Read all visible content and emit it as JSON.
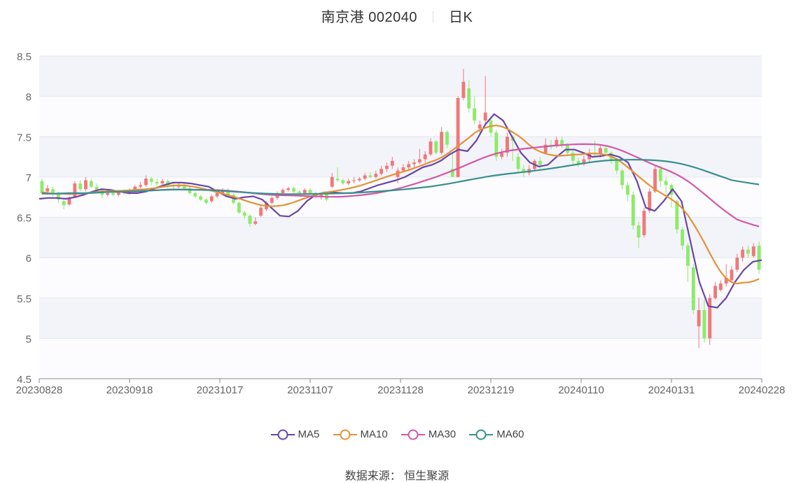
{
  "header": {
    "title": "南京港 002040",
    "period": "日K"
  },
  "source": {
    "label": "数据来源：",
    "value": "恒生聚源"
  },
  "colors": {
    "up": "#f07878",
    "down": "#8deb6a",
    "grid_band": "#f3f4fa",
    "MA5": "#6a45a8",
    "MA10": "#e39236",
    "MA30": "#d457a6",
    "MA60": "#37908f"
  },
  "chart_data": {
    "type": "candlestick",
    "title": "南京港 002040 日K",
    "ylim": [
      4.5,
      8.5
    ],
    "yticks": [
      "4.5",
      "5",
      "5.5",
      "6",
      "6.5",
      "7",
      "7.5",
      "8",
      "8.5"
    ],
    "xticks": [
      "20230828",
      "20230918",
      "20231017",
      "20231107",
      "20231128",
      "20231219",
      "20240110",
      "20240131",
      "20240228"
    ],
    "ohlc": [
      [
        6.95,
        6.8,
        6.98,
        6.78
      ],
      [
        6.82,
        6.86,
        6.9,
        6.78
      ],
      [
        6.85,
        6.8,
        6.88,
        6.76
      ],
      [
        6.8,
        6.72,
        6.82,
        6.68
      ],
      [
        6.7,
        6.65,
        6.72,
        6.6
      ],
      [
        6.66,
        6.74,
        6.76,
        6.64
      ],
      [
        6.75,
        6.92,
        6.95,
        6.74
      ],
      [
        6.92,
        6.85,
        6.96,
        6.82
      ],
      [
        6.85,
        6.96,
        7.0,
        6.82
      ],
      [
        6.95,
        6.88,
        6.98,
        6.86
      ],
      [
        6.88,
        6.84,
        6.92,
        6.8
      ],
      [
        6.84,
        6.78,
        6.86,
        6.74
      ],
      [
        6.78,
        6.8,
        6.82,
        6.76
      ],
      [
        6.8,
        6.78,
        6.84,
        6.76
      ],
      [
        6.78,
        6.82,
        6.84,
        6.76
      ],
      [
        6.82,
        6.8,
        6.85,
        6.78
      ],
      [
        6.8,
        6.84,
        6.86,
        6.78
      ],
      [
        6.84,
        6.88,
        6.9,
        6.82
      ],
      [
        6.88,
        6.9,
        6.94,
        6.86
      ],
      [
        6.9,
        6.98,
        7.02,
        6.88
      ],
      [
        6.98,
        6.94,
        7.0,
        6.9
      ],
      [
        6.94,
        6.92,
        6.98,
        6.88
      ],
      [
        6.92,
        6.95,
        6.98,
        6.9
      ],
      [
        6.95,
        6.9,
        6.97,
        6.86
      ],
      [
        6.9,
        6.88,
        6.92,
        6.85
      ],
      [
        6.88,
        6.9,
        6.93,
        6.86
      ],
      [
        6.9,
        6.86,
        6.92,
        6.84
      ],
      [
        6.86,
        6.8,
        6.88,
        6.78
      ],
      [
        6.8,
        6.76,
        6.82,
        6.74
      ],
      [
        6.76,
        6.72,
        6.78,
        6.7
      ],
      [
        6.72,
        6.68,
        6.74,
        6.66
      ],
      [
        6.7,
        6.76,
        6.78,
        6.68
      ],
      [
        6.76,
        6.8,
        6.82,
        6.74
      ],
      [
        6.8,
        6.84,
        6.86,
        6.78
      ],
      [
        6.84,
        6.78,
        6.86,
        6.76
      ],
      [
        6.78,
        6.68,
        6.8,
        6.66
      ],
      [
        6.68,
        6.56,
        6.7,
        6.54
      ],
      [
        6.56,
        6.52,
        6.58,
        6.48
      ],
      [
        6.52,
        6.42,
        6.54,
        6.38
      ],
      [
        6.42,
        6.45,
        6.5,
        6.4
      ],
      [
        6.52,
        6.62,
        6.65,
        6.5
      ],
      [
        6.6,
        6.68,
        6.7,
        6.58
      ],
      [
        6.68,
        6.74,
        6.76,
        6.66
      ],
      [
        6.74,
        6.8,
        6.82,
        6.72
      ],
      [
        6.8,
        6.84,
        6.86,
        6.78
      ],
      [
        6.84,
        6.86,
        6.88,
        6.82
      ],
      [
        6.86,
        6.82,
        6.88,
        6.8
      ],
      [
        6.82,
        6.8,
        6.84,
        6.78
      ],
      [
        6.8,
        6.84,
        6.86,
        6.78
      ],
      [
        6.84,
        6.8,
        6.86,
        6.78
      ],
      [
        6.8,
        6.76,
        6.82,
        6.74
      ],
      [
        6.76,
        6.78,
        6.8,
        6.72
      ],
      [
        6.8,
        6.72,
        6.82,
        6.7
      ],
      [
        6.88,
        7.0,
        7.05,
        6.86
      ],
      [
        6.98,
        6.96,
        7.12,
        6.94
      ],
      [
        6.96,
        6.92,
        6.98,
        6.9
      ],
      [
        6.92,
        6.95,
        6.98,
        6.9
      ],
      [
        6.95,
        6.96,
        7.0,
        6.92
      ],
      [
        6.96,
        6.98,
        7.0,
        6.94
      ],
      [
        6.98,
        7.02,
        7.05,
        6.96
      ],
      [
        7.02,
        7.0,
        7.06,
        6.98
      ],
      [
        7.0,
        7.04,
        7.08,
        6.98
      ],
      [
        7.04,
        7.1,
        7.14,
        7.02
      ],
      [
        7.1,
        7.14,
        7.18,
        7.06
      ],
      [
        7.14,
        7.2,
        7.25,
        7.1
      ],
      [
        7.0,
        7.08,
        7.12,
        6.92
      ],
      [
        7.08,
        7.12,
        7.16,
        7.06
      ],
      [
        7.12,
        7.16,
        7.2,
        7.08
      ],
      [
        7.16,
        7.18,
        7.22,
        7.12
      ],
      [
        7.18,
        7.22,
        7.35,
        7.16
      ],
      [
        7.22,
        7.28,
        7.32,
        7.18
      ],
      [
        7.28,
        7.44,
        7.48,
        7.26
      ],
      [
        7.44,
        7.3,
        7.46,
        7.28
      ],
      [
        7.3,
        7.56,
        7.62,
        7.28
      ],
      [
        7.56,
        7.4,
        7.58,
        7.36
      ],
      [
        7.1,
        7.0,
        7.3,
        7.0
      ],
      [
        7.0,
        7.98,
        8.0,
        7.02
      ],
      [
        7.98,
        8.18,
        8.34,
        7.95
      ],
      [
        8.1,
        7.85,
        8.2,
        7.8
      ],
      [
        7.85,
        7.7,
        8.0,
        7.65
      ],
      [
        7.6,
        7.65,
        7.7,
        7.55
      ],
      [
        7.7,
        7.8,
        8.25,
        7.66
      ],
      [
        7.7,
        7.55,
        7.75,
        7.5
      ],
      [
        7.55,
        7.25,
        7.58,
        7.2
      ],
      [
        7.25,
        7.3,
        7.35,
        7.22
      ],
      [
        7.3,
        7.5,
        7.55,
        7.25
      ],
      [
        7.5,
        7.45,
        7.52,
        7.2
      ],
      [
        7.25,
        7.1,
        7.3,
        7.05
      ],
      [
        7.1,
        7.05,
        7.15,
        7.0
      ],
      [
        7.05,
        7.1,
        7.15,
        7.02
      ],
      [
        7.1,
        7.2,
        7.22,
        7.08
      ],
      [
        7.2,
        7.15,
        7.25,
        7.1
      ],
      [
        7.3,
        7.4,
        7.48,
        7.28
      ],
      [
        7.4,
        7.38,
        7.46,
        7.34
      ],
      [
        7.38,
        7.46,
        7.5,
        7.36
      ],
      [
        7.46,
        7.4,
        7.5,
        7.36
      ],
      [
        7.4,
        7.3,
        7.42,
        7.26
      ],
      [
        7.3,
        7.2,
        7.34,
        7.16
      ],
      [
        7.2,
        7.16,
        7.24,
        7.12
      ],
      [
        7.16,
        7.22,
        7.26,
        7.14
      ],
      [
        7.22,
        7.3,
        7.35,
        7.18
      ],
      [
        7.3,
        7.28,
        7.45,
        7.26
      ],
      [
        7.28,
        7.36,
        7.4,
        7.24
      ],
      [
        7.36,
        7.3,
        7.4,
        7.26
      ],
      [
        7.3,
        7.2,
        7.32,
        7.16
      ],
      [
        7.2,
        7.08,
        7.22,
        7.04
      ],
      [
        7.08,
        6.9,
        7.1,
        6.85
      ],
      [
        6.9,
        6.78,
        6.94,
        6.7
      ],
      [
        6.78,
        6.4,
        6.82,
        6.35
      ],
      [
        6.4,
        6.25,
        6.45,
        6.12
      ],
      [
        6.28,
        6.58,
        6.62,
        6.25
      ],
      [
        6.58,
        6.82,
        6.86,
        6.55
      ],
      [
        6.82,
        7.1,
        7.15,
        6.8
      ],
      [
        7.1,
        6.95,
        7.14,
        6.88
      ],
      [
        6.95,
        6.9,
        7.0,
        6.72
      ],
      [
        6.9,
        6.78,
        6.92,
        6.62
      ],
      [
        6.7,
        6.35,
        6.72,
        6.3
      ],
      [
        6.35,
        6.15,
        6.38,
        6.1
      ],
      [
        6.15,
        5.9,
        6.18,
        5.7
      ],
      [
        5.88,
        5.35,
        5.92,
        5.3
      ],
      [
        5.15,
        5.35,
        5.5,
        4.88
      ],
      [
        5.35,
        5.0,
        5.48,
        4.95
      ],
      [
        5.0,
        5.5,
        5.55,
        4.92
      ],
      [
        5.5,
        5.65,
        5.7,
        5.48
      ],
      [
        5.6,
        5.68,
        5.72,
        5.58
      ],
      [
        5.68,
        5.75,
        5.92,
        5.64
      ],
      [
        5.72,
        5.85,
        5.9,
        5.7
      ],
      [
        5.85,
        6.0,
        6.05,
        5.82
      ],
      [
        6.0,
        6.1,
        6.14,
        5.95
      ],
      [
        6.1,
        6.05,
        6.15,
        6.0
      ],
      [
        6.02,
        6.14,
        6.18,
        6.0
      ],
      [
        6.15,
        5.85,
        6.2,
        5.8
      ]
    ],
    "ma": {
      "MA5": [
        6.73,
        6.74,
        6.74,
        6.73,
        6.75,
        6.78,
        6.82,
        6.85,
        6.84,
        6.82,
        6.8,
        6.8,
        6.82,
        6.86,
        6.9,
        6.93,
        6.93,
        6.92,
        6.9,
        6.88,
        6.82,
        6.76,
        6.73,
        6.75,
        6.76,
        6.72,
        6.62,
        6.52,
        6.51,
        6.58,
        6.7,
        6.78,
        6.81,
        6.81,
        6.8,
        6.8,
        6.82,
        6.86,
        6.9,
        6.93,
        6.96,
        7.0,
        7.06,
        7.12,
        7.15,
        7.2,
        7.28,
        7.34,
        7.32,
        7.45,
        7.65,
        7.78,
        7.7,
        7.5,
        7.3,
        7.18,
        7.13,
        7.15,
        7.25,
        7.34,
        7.34,
        7.3,
        7.25,
        7.26,
        7.28,
        7.25,
        7.18,
        6.95,
        6.62,
        6.58,
        6.7,
        6.85,
        6.7,
        6.2,
        5.7,
        5.4,
        5.38,
        5.5,
        5.7,
        5.85,
        5.95,
        5.97
      ]
    }
  },
  "legend": [
    "MA5",
    "MA10",
    "MA30",
    "MA60"
  ]
}
